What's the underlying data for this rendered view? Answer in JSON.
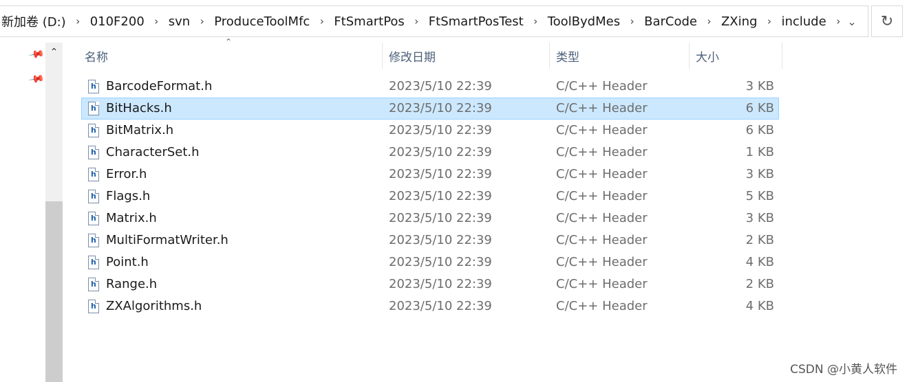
{
  "breadcrumb": [
    "新加卷 (D:)",
    "010F200",
    "svn",
    "ProduceToolMfc",
    "FtSmartPos",
    "FtSmartPosTest",
    "ToolBydMes",
    "BarCode",
    "ZXing",
    "include"
  ],
  "columns": {
    "name": "名称",
    "date": "修改日期",
    "type": "类型",
    "size": "大小"
  },
  "files": [
    {
      "name": "BarcodeFormat.h",
      "date": "2023/5/10 22:39",
      "type": "C/C++ Header",
      "size": "3 KB",
      "selected": false
    },
    {
      "name": "BitHacks.h",
      "date": "2023/5/10 22:39",
      "type": "C/C++ Header",
      "size": "6 KB",
      "selected": true
    },
    {
      "name": "BitMatrix.h",
      "date": "2023/5/10 22:39",
      "type": "C/C++ Header",
      "size": "6 KB",
      "selected": false
    },
    {
      "name": "CharacterSet.h",
      "date": "2023/5/10 22:39",
      "type": "C/C++ Header",
      "size": "1 KB",
      "selected": false
    },
    {
      "name": "Error.h",
      "date": "2023/5/10 22:39",
      "type": "C/C++ Header",
      "size": "3 KB",
      "selected": false
    },
    {
      "name": "Flags.h",
      "date": "2023/5/10 22:39",
      "type": "C/C++ Header",
      "size": "5 KB",
      "selected": false
    },
    {
      "name": "Matrix.h",
      "date": "2023/5/10 22:39",
      "type": "C/C++ Header",
      "size": "3 KB",
      "selected": false
    },
    {
      "name": "MultiFormatWriter.h",
      "date": "2023/5/10 22:39",
      "type": "C/C++ Header",
      "size": "2 KB",
      "selected": false
    },
    {
      "name": "Point.h",
      "date": "2023/5/10 22:39",
      "type": "C/C++ Header",
      "size": "4 KB",
      "selected": false
    },
    {
      "name": "Range.h",
      "date": "2023/5/10 22:39",
      "type": "C/C++ Header",
      "size": "2 KB",
      "selected": false
    },
    {
      "name": "ZXAlgorithms.h",
      "date": "2023/5/10 22:39",
      "type": "C/C++ Header",
      "size": "4 KB",
      "selected": false
    }
  ],
  "file_icon_glyph": "h",
  "icons": {
    "separator": "chevron-right-icon",
    "history": "chevron-down-icon",
    "refresh": "refresh-icon",
    "pin": "pin-icon",
    "sort": "sort-ascending-icon",
    "file": "header-file-icon"
  },
  "watermark": "CSDN @小黄人软件",
  "colors": {
    "selection_bg": "#cce8ff",
    "selection_border": "#99d1ff",
    "header_text": "#4c607a"
  }
}
